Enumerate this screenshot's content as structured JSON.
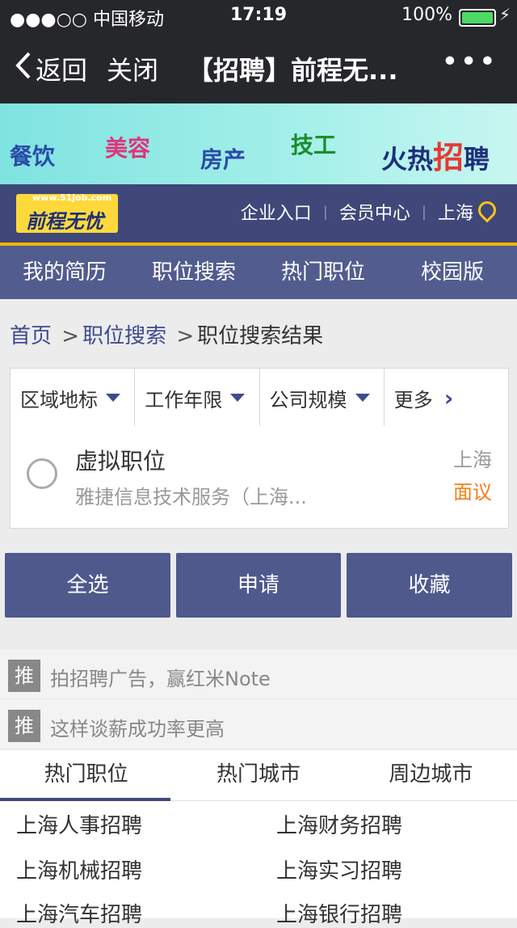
{
  "status": {
    "carrier": "●●●○○ 中国移动",
    "time": "17:19",
    "battery": "100%",
    "battery_level": 1.0
  },
  "nav": {
    "back": "返回",
    "close": "关闭",
    "title": "【招聘】前程无...",
    "more": "•••"
  },
  "banner": {
    "items": [
      "餐饮",
      "美容",
      "房产",
      "技工"
    ],
    "slogan_a": "火热",
    "slogan_b": "招",
    "slogan_c": "聘"
  },
  "header": {
    "logo_small": "www.51job.com",
    "logo_big": "前程无忧",
    "links": [
      "企业入口",
      "会员中心",
      "上海"
    ]
  },
  "menu": [
    "我的简历",
    "职位搜索",
    "热门职位",
    "校园版"
  ],
  "breadcrumb": {
    "home": "首页",
    "sep": ">",
    "search": "职位搜索",
    "current": "职位搜索结果"
  },
  "filters": [
    "区域地标",
    "工作年限",
    "公司规模",
    "更多"
  ],
  "job": {
    "title": "虚拟职位",
    "company": "雅捷信息技术服务（上海...",
    "city": "上海",
    "salary": "面议"
  },
  "actions": [
    "全选",
    "申请",
    "收藏"
  ],
  "promos": [
    {
      "tag": "推",
      "text": "拍招聘广告，赢红米Note"
    },
    {
      "tag": "推",
      "text": "这样谈薪成功率更高"
    }
  ],
  "tabs": [
    "热门职位",
    "热门城市",
    "周边城市"
  ],
  "links": [
    "上海人事招聘",
    "上海财务招聘",
    "上海机械招聘",
    "上海实习招聘",
    "上海汽车招聘",
    "上海银行招聘"
  ],
  "colors": {
    "nav_bg": "#3f4878",
    "menu_bg": "#525c8e",
    "accent_yellow": "#f5b400",
    "salary": "#f57f17",
    "battery": "#4cd964"
  }
}
